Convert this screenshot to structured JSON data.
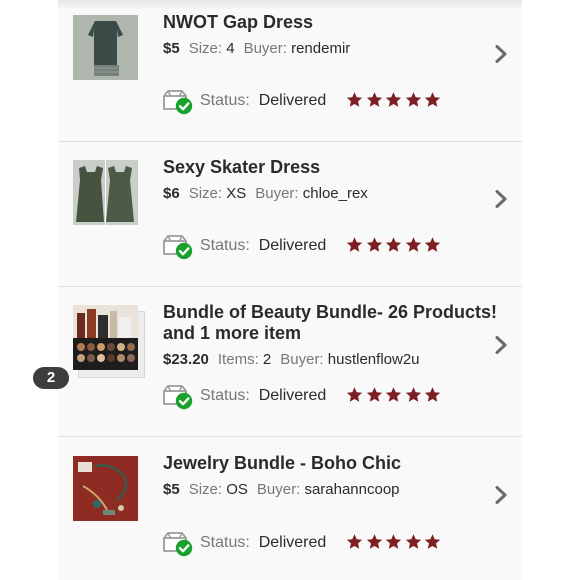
{
  "accent_star_color": "#7d1f23",
  "accent_check_color": "#1aa02c",
  "items": [
    {
      "title": "NWOT Gap Dress",
      "title_line2": "",
      "price": "$5",
      "qty_label": "Size:",
      "qty_value": "4",
      "buyer_label": "Buyer:",
      "buyer": "rendemir",
      "status_label": "Status:",
      "status": "Delivered",
      "rating": 5,
      "thumb_icon": "dress-photo"
    },
    {
      "title": "Sexy Skater Dress",
      "title_line2": "",
      "price": "$6",
      "qty_label": "Size:",
      "qty_value": "XS",
      "buyer_label": "Buyer:",
      "buyer": "chloe_rex",
      "status_label": "Status:",
      "status": "Delivered",
      "rating": 5,
      "thumb_icon": "skater-dress-photo"
    },
    {
      "title": "Bundle of Beauty Bundle- 26 Products!",
      "title_line2": "and 1 more item",
      "price": "$23.20",
      "qty_label": "Items:",
      "qty_value": "2",
      "buyer_label": "Buyer:",
      "buyer": "hustlenflow2u",
      "status_label": "Status:",
      "status": "Delivered",
      "rating": 5,
      "badge": "2",
      "thumb_icon": "beauty-products-photo"
    },
    {
      "title": "Jewelry Bundle - Boho Chic",
      "title_line2": "",
      "price": "$5",
      "qty_label": "Size:",
      "qty_value": "OS",
      "buyer_label": "Buyer:",
      "buyer": "sarahanncoop",
      "status_label": "Status:",
      "status": "Delivered",
      "rating": 5,
      "thumb_icon": "jewelry-photo"
    }
  ]
}
